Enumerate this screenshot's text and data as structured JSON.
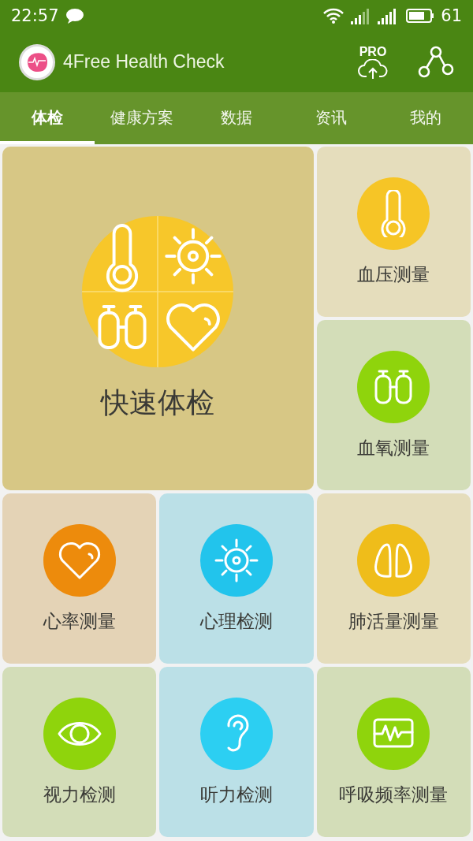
{
  "status_bar": {
    "time": "22:57",
    "battery": "61"
  },
  "app_bar": {
    "title": "4Free Health Check",
    "pro_badge": "PRO"
  },
  "tabs": [
    {
      "label": "体检",
      "selected": true
    },
    {
      "label": "健康方案",
      "selected": false
    },
    {
      "label": "数据",
      "selected": false
    },
    {
      "label": "资讯",
      "selected": false
    },
    {
      "label": "我的",
      "selected": false
    }
  ],
  "tiles": [
    {
      "kind": "big",
      "label": "快速体检",
      "color": "#d7c785",
      "icon": {
        "kind": "combo",
        "color": "#f7c72a"
      }
    },
    {
      "kind": "small",
      "label": "血压测量",
      "color": "#e5ddbc",
      "icon": {
        "kind": "thermometer",
        "color": "#f6c526"
      }
    },
    {
      "kind": "small",
      "label": "血氧测量",
      "color": "#d3ddb8",
      "icon": {
        "kind": "bottles",
        "color": "#8fd40c"
      }
    },
    {
      "kind": "small",
      "label": "心率测量",
      "color": "#e4d3b6",
      "icon": {
        "kind": "heart",
        "color": "#ed8b0c"
      }
    },
    {
      "kind": "small",
      "label": "心理检测",
      "color": "#bbe0e7",
      "icon": {
        "kind": "virus",
        "color": "#22c4ec"
      }
    },
    {
      "kind": "small",
      "label": "肺活量测量",
      "color": "#e5ddbc",
      "icon": {
        "kind": "lungs",
        "color": "#efbd1a"
      }
    },
    {
      "kind": "small",
      "label": "视力检测",
      "color": "#d3ddb8",
      "icon": {
        "kind": "eye",
        "color": "#8fd40c"
      }
    },
    {
      "kind": "small",
      "label": "听力检测",
      "color": "#bbe0e7",
      "icon": {
        "kind": "ear",
        "color": "#2ccff2"
      }
    },
    {
      "kind": "small",
      "label": "呼吸频率测量",
      "color": "#d3ddb8",
      "icon": {
        "kind": "monitor",
        "color": "#8fd40c"
      }
    }
  ]
}
